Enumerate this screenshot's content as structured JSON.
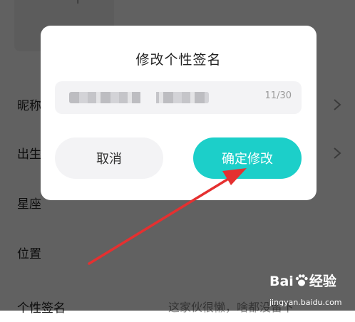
{
  "dialog": {
    "title": "修改个性签名",
    "counter": "11/30",
    "cancel_label": "取消",
    "confirm_label": "确定修改"
  },
  "settings": {
    "add_symbol": "+",
    "rows": [
      {
        "label": "昵称",
        "value": ""
      },
      {
        "label": "出生",
        "value": ""
      },
      {
        "label": "星座",
        "value": ""
      },
      {
        "label": "位置",
        "value": ""
      },
      {
        "label": "个性签名",
        "value": "这家伙很懒，啥都没留下"
      }
    ]
  },
  "watermark": {
    "brand_left": "Bai",
    "brand_right": "经验",
    "url": "jingyan.baidu.com"
  },
  "colors": {
    "accent": "#1ccfc9",
    "arrow": "#e53030",
    "overlay": "rgba(0,0,0,0.62)"
  }
}
